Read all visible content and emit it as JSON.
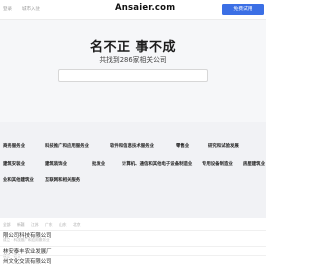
{
  "header": {
    "nav_links": [
      "登录",
      "城市入驻"
    ],
    "logo": "Ansaier.com",
    "cta_label": "免费试用"
  },
  "hero": {
    "title": "名不正 事不成",
    "subtitle": "共找到286家相关公司"
  },
  "categories": [
    "商务服务业",
    "科技推广和应用服务业",
    "软件和信息技术服务业",
    "零售业",
    "研究和试验发展",
    "建筑安装业",
    "建筑装饰业",
    "批发业",
    "计算机、通信和其他电子设备制造业",
    "专用设备制造业",
    "房屋建筑业",
    "业和其他建筑业",
    "互联网和相关服务"
  ],
  "filters": [
    "全部",
    "新疆",
    "江苏",
    "广东",
    "山东",
    "北京"
  ],
  "companies": [
    {
      "name": "限公司科技有限公司",
      "meta": "成立 · 科技推广和应用服务业"
    },
    {
      "name": "林安泰丰农业发展厂",
      "meta": "成立 · 农业"
    },
    {
      "name": "州文化交流有限公司",
      "meta": ""
    }
  ],
  "colors": {
    "accent": "#3b6fe5",
    "hero_bg": "#f6f7f9",
    "category_bg": "#f1f2f5"
  }
}
